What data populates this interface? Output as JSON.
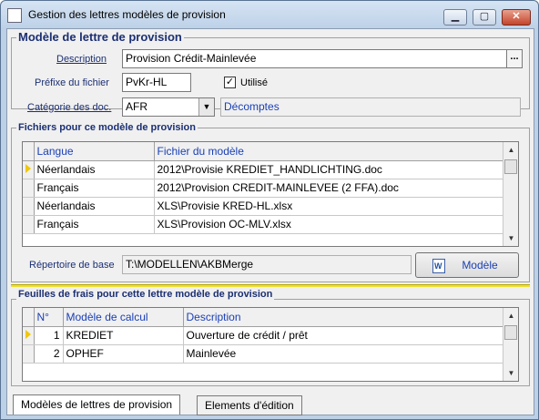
{
  "window": {
    "title": "Gestion des lettres modèles de provision",
    "min_label": "▁",
    "max_label": "▢",
    "close_label": "✕"
  },
  "model_group": {
    "title": "Modèle de lettre de provision",
    "description_label": "Description",
    "description_value": "Provision Crédit-Mainlevée",
    "description_btn": "...",
    "prefix_label": "Préfixe du fichier",
    "prefix_value": "PvKr-HL",
    "used_label": "Utilisé",
    "used_checked": "✓",
    "category_label": "Catégorie des doc.",
    "category_value": "AFR",
    "category_name": "Décomptes"
  },
  "files_group": {
    "title": "Fichiers pour ce modèle de provision",
    "columns": [
      "Langue",
      "Fichier du modèle"
    ],
    "rows": [
      {
        "lang": "Néerlandais",
        "file": "2012\\Provisie KREDIET_HANDLICHTING.doc"
      },
      {
        "lang": "Français",
        "file": "2012\\Provision CREDIT-MAINLEVEE (2 FFA).doc"
      },
      {
        "lang": "Néerlandais",
        "file": "XLS\\Provisie KRED-HL.xlsx"
      },
      {
        "lang": "Français",
        "file": "XLS\\Provision OC-MLV.xlsx"
      }
    ],
    "base_dir_label": "Répertoire de base",
    "base_dir_value": "T:\\MODELLEN\\AKBMerge",
    "model_button": "Modèle"
  },
  "fees_group": {
    "title": "Feuilles de frais pour cette lettre modèle de provision",
    "columns": [
      "N°",
      "Modèle de calcul",
      "Description"
    ],
    "rows": [
      {
        "n": "1",
        "model": "KREDIET",
        "desc": "Ouverture de crédit / prêt"
      },
      {
        "n": "2",
        "model": "OPHEF",
        "desc": "Mainlevée"
      }
    ]
  },
  "tabs": [
    "Modèles de lettres de provision",
    "Elements d'édition"
  ],
  "colors": {
    "accent_blue": "#1a3fb5",
    "group_title": "#1b2f73",
    "indicator": "#f0c800"
  }
}
